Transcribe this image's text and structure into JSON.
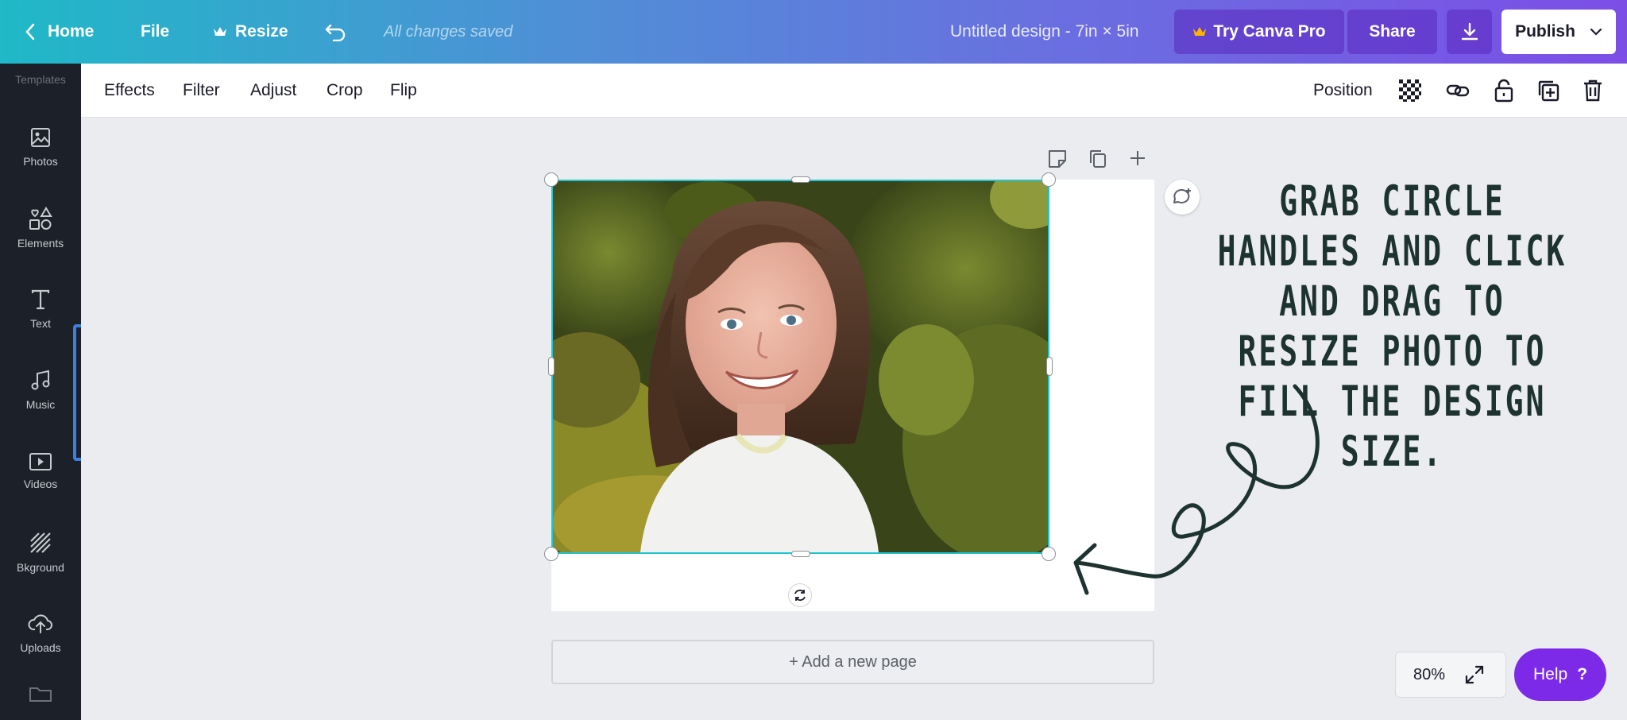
{
  "topbar": {
    "home_label": "Home",
    "file_label": "File",
    "resize_label": "Resize",
    "saved_status": "All changes saved",
    "design_title": "Untitled design - 7in × 5in",
    "try_pro_label": "Try Canva Pro",
    "share_label": "Share",
    "publish_label": "Publish"
  },
  "sidebar": {
    "top_label": "Templates",
    "items": [
      {
        "label": "Photos",
        "icon": "photo-icon"
      },
      {
        "label": "Elements",
        "icon": "shapes-icon"
      },
      {
        "label": "Text",
        "icon": "text-icon"
      },
      {
        "label": "Music",
        "icon": "music-icon"
      },
      {
        "label": "Videos",
        "icon": "video-icon"
      },
      {
        "label": "Bkground",
        "icon": "background-icon"
      },
      {
        "label": "Uploads",
        "icon": "upload-icon"
      }
    ]
  },
  "edit_toolbar": {
    "effects": "Effects",
    "filter": "Filter",
    "adjust": "Adjust",
    "crop": "Crop",
    "flip": "Flip",
    "position": "Position"
  },
  "canvas": {
    "add_page_label": "+ Add a new page",
    "annotation_text": "Grab circle handles and click and drag to resize photo to fill the design size."
  },
  "footer": {
    "zoom_level": "80%",
    "help_label": "Help",
    "help_icon": "?"
  },
  "colors": {
    "selection_border": "#1fc4d0",
    "help_button": "#7d2ae8",
    "sidebar_bg": "#1b2029"
  }
}
